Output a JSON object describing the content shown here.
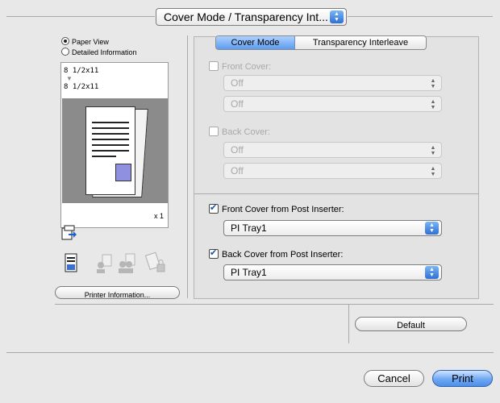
{
  "top_popup": {
    "label": "Cover Mode / Transparency Int..."
  },
  "view_options": [
    {
      "label": "Paper View",
      "selected": true
    },
    {
      "label": "Detailed Information",
      "selected": false
    }
  ],
  "preview": {
    "paper_top": "8 1/2x11",
    "paper_bottom": "8 1/2x11",
    "copies": "x 1"
  },
  "printer_info_button": "Printer Information...",
  "tabs": [
    {
      "label": "Cover Mode",
      "active": true
    },
    {
      "label": "Transparency Interleave",
      "active": false
    }
  ],
  "front_cover": {
    "label": "Front Cover:",
    "checked": false,
    "enabled": false,
    "paper_source": "Off",
    "paper_type": "Off"
  },
  "back_cover": {
    "label": "Back Cover:",
    "checked": false,
    "enabled": false,
    "paper_source": "Off",
    "paper_type": "Off"
  },
  "front_post_inserter": {
    "label": "Front Cover from Post Inserter:",
    "checked": true,
    "value": "PI Tray1"
  },
  "back_post_inserter": {
    "label": "Back Cover from Post Inserter:",
    "checked": true,
    "value": "PI Tray1"
  },
  "default_button": "Default",
  "cancel_button": "Cancel",
  "print_button": "Print"
}
